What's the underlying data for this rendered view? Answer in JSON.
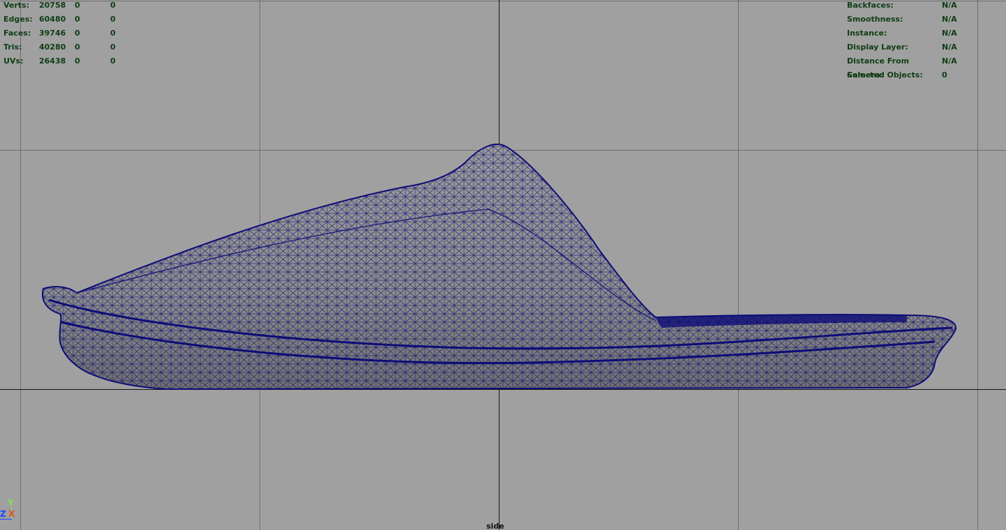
{
  "hud_left": {
    "rows": [
      {
        "label": "Verts:",
        "v1": "20758",
        "v2": "0",
        "v3": "0"
      },
      {
        "label": "Edges:",
        "v1": "60480",
        "v2": "0",
        "v3": "0"
      },
      {
        "label": "Faces:",
        "v1": "39746",
        "v2": "0",
        "v3": "0"
      },
      {
        "label": "Tris:",
        "v1": "40280",
        "v2": "0",
        "v3": "0"
      },
      {
        "label": "UVs:",
        "v1": "26438",
        "v2": "0",
        "v3": "0"
      }
    ]
  },
  "hud_right": {
    "rows": [
      {
        "label": "Backfaces:",
        "value": "N/A"
      },
      {
        "label": "Smoothness:",
        "value": "N/A"
      },
      {
        "label": "Instance:",
        "value": "N/A"
      },
      {
        "label": "Display Layer:",
        "value": "N/A"
      },
      {
        "label": "Distance From Camera:",
        "value": "N/A"
      },
      {
        "label": "Selected Objects:",
        "value": "0"
      }
    ]
  },
  "camera": {
    "name": "side"
  },
  "axis": {
    "y": "Y",
    "z": "Z",
    "x": "X"
  },
  "colors": {
    "background": "#a0a0a0",
    "grid": "#6e6e6e",
    "axis_line": "#111111",
    "hud_text": "#0f3d14",
    "wireframe": "#0c0c78",
    "shaded": "#8a8a8a"
  }
}
